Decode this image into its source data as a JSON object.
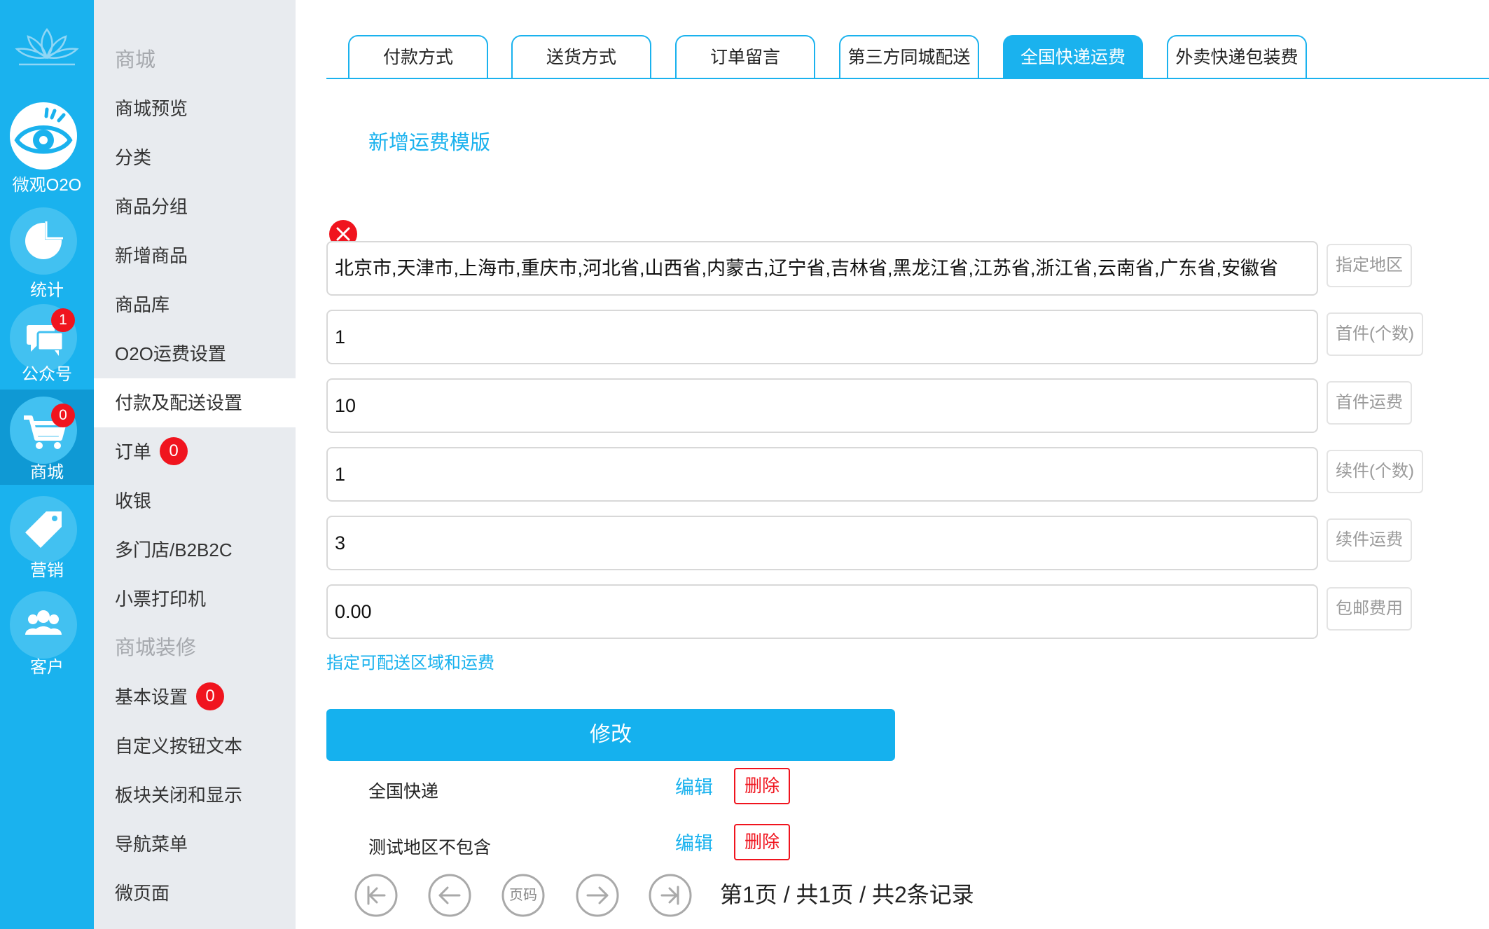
{
  "rail": {
    "items": [
      {
        "label": "微观O2O",
        "icon": "eye-icon",
        "badge": ""
      },
      {
        "label": "统计",
        "icon": "pie-chart-icon",
        "badge": ""
      },
      {
        "label": "公众号",
        "icon": "chat-bubbles-icon",
        "badge": "1"
      },
      {
        "label": "商城",
        "icon": "shopping-cart-icon",
        "badge": "0"
      },
      {
        "label": "营销",
        "icon": "tag-icon",
        "badge": ""
      },
      {
        "label": "客户",
        "icon": "users-icon",
        "badge": ""
      }
    ],
    "active_index": 3
  },
  "sidebar": {
    "items": [
      {
        "label": "商城",
        "type": "header"
      },
      {
        "label": "商城预览"
      },
      {
        "label": "分类"
      },
      {
        "label": "商品分组"
      },
      {
        "label": "新增商品"
      },
      {
        "label": "商品库"
      },
      {
        "label": "O2O运费设置"
      },
      {
        "label": "付款及配送设置",
        "active": true
      },
      {
        "label": "订单",
        "badge": "0"
      },
      {
        "label": "收银"
      },
      {
        "label": "多门店/B2B2C"
      },
      {
        "label": "小票打印机"
      },
      {
        "label": "商城装修",
        "type": "header"
      },
      {
        "label": "基本设置",
        "badge": "0"
      },
      {
        "label": "自定义按钮文本"
      },
      {
        "label": "板块关闭和显示"
      },
      {
        "label": "导航菜单"
      },
      {
        "label": "微页面"
      }
    ]
  },
  "tabs": [
    {
      "label": "付款方式"
    },
    {
      "label": "送货方式"
    },
    {
      "label": "订单留言"
    },
    {
      "label": "第三方同城配送"
    },
    {
      "label": "全国快递运费",
      "active": true
    },
    {
      "label": "外卖快递包装费"
    }
  ],
  "add_template_label": "新增运费模版",
  "form": {
    "region_value": "北京市,天津市,上海市,重庆市,河北省,山西省,内蒙古,辽宁省,吉林省,黑龙江省,江苏省,浙江省,云南省,广东省,安徽省",
    "region_addon": "指定地区",
    "first_count_value": "1",
    "first_count_addon": "首件(个数)",
    "first_fee_value": "10",
    "first_fee_addon": "首件运费",
    "extra_count_value": "1",
    "extra_count_addon": "续件(个数)",
    "extra_fee_value": "3",
    "extra_fee_addon": "续件运费",
    "free_shipping_value": "0.00",
    "free_shipping_addon": "包邮费用",
    "assign_link": "指定可配送区域和运费",
    "submit_label": "修改"
  },
  "templates": [
    {
      "name": "全国快递",
      "edit_label": "编辑",
      "delete_label": "删除"
    },
    {
      "name": "测试地区不包含",
      "edit_label": "编辑",
      "delete_label": "删除"
    }
  ],
  "pager": {
    "page_button_label": "页码",
    "info": "第1页 / 共1页 / 共2条记录"
  },
  "colors": {
    "accent": "#1ab2ee",
    "rail_bg": "#1ab2ee",
    "sidebar_bg": "#e8ebef",
    "badge_red": "#f0141e"
  }
}
